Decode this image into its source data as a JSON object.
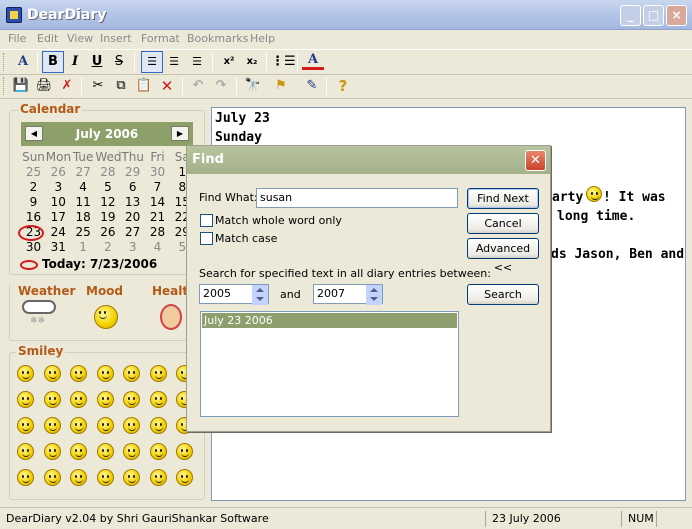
{
  "window": {
    "title": "DearDiary",
    "minimize": "_",
    "maximize": "□",
    "close": "×"
  },
  "menu": [
    "File",
    "Edit",
    "View",
    "Insert",
    "Format",
    "Bookmarks",
    "Help"
  ],
  "toolbar1": {
    "font_color": "A",
    "bold": "B",
    "italic": "I",
    "underline": "U",
    "strike": "S",
    "superscript": "x²",
    "subscript": "x₂",
    "text_color": "A"
  },
  "toolbar2": {
    "save": "💾",
    "print": "🖨",
    "delete_entry": "✗",
    "cut": "✂",
    "copy": "⧉",
    "paste": "📋",
    "delete": "✕",
    "undo": "↶",
    "redo": "↷",
    "find": "🔭",
    "bookmark": "⚑",
    "properties": "✎",
    "help": "?"
  },
  "calendar": {
    "title": "Calendar",
    "month_label": "July 2006",
    "prev": "◀",
    "next": "▶",
    "weekdays": [
      "Sun",
      "Mon",
      "Tue",
      "Wed",
      "Thu",
      "Fri",
      "Sa"
    ],
    "weeks": [
      [
        "25",
        "26",
        "27",
        "28",
        "29",
        "30",
        "1"
      ],
      [
        "2",
        "3",
        "4",
        "5",
        "6",
        "7",
        "8"
      ],
      [
        "9",
        "10",
        "11",
        "12",
        "13",
        "14",
        "15"
      ],
      [
        "16",
        "17",
        "18",
        "19",
        "20",
        "21",
        "22"
      ],
      [
        "23",
        "24",
        "25",
        "26",
        "27",
        "28",
        "29"
      ],
      [
        "30",
        "31",
        "1",
        "2",
        "3",
        "4",
        "5"
      ]
    ],
    "today_label": "Today: 7/23/2006"
  },
  "categories": {
    "weather": "Weather",
    "mood": "Mood",
    "health": "Health"
  },
  "smiley": {
    "title": "Smiley",
    "rows": 5,
    "cols": 7
  },
  "editor": {
    "line1": "July 23",
    "line2": "Sunday",
    "line3a": "arty",
    "line3b": "! It was",
    "line4": "long time.",
    "line5": "ds Jason, Ben and"
  },
  "find": {
    "title": "Find",
    "find_what_label": "Find What:",
    "find_what_value": "susan",
    "match_whole_word": "Match whole word only",
    "match_case": "Match case",
    "find_next": "Find Next",
    "cancel": "Cancel",
    "advanced": "Advanced <<",
    "search_range_label": "Search for specified text in all diary entries between:",
    "from_year": "2005",
    "and_label": "and",
    "to_year": "2007",
    "search_button": "Search",
    "results": [
      "July 23 2006"
    ]
  },
  "status": {
    "version": "DearDiary v2.04 by Shri GauriShankar Software",
    "date": "23 July 2006",
    "num": "NUM"
  }
}
